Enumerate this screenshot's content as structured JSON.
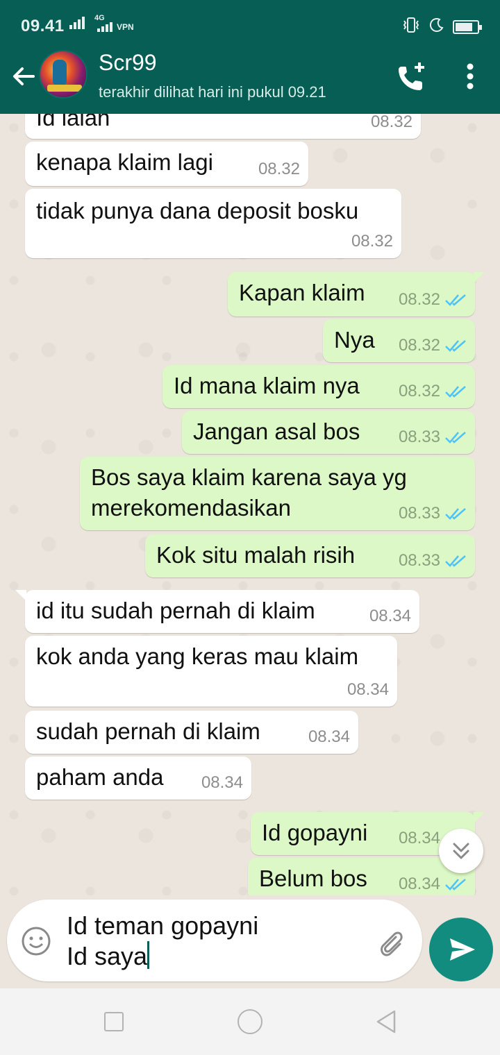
{
  "status_bar": {
    "time": "09.41",
    "network": "4G",
    "vpn": "VPN"
  },
  "header": {
    "contact_name": "Scr99",
    "last_seen": "terakhir dilihat hari ini pukul 09.21",
    "icons": [
      "arrow-back-icon",
      "add-call-icon",
      "more-vert-icon"
    ]
  },
  "messages": [
    {
      "dir": "in",
      "text": "Id lalan",
      "time": "08.32"
    },
    {
      "dir": "in",
      "text": "kenapa klaim lagi",
      "time": "08.32"
    },
    {
      "dir": "in",
      "text": "tidak punya dana deposit bosku",
      "time": "08.32"
    },
    {
      "dir": "out",
      "text": "Kapan klaim",
      "time": "08.32"
    },
    {
      "dir": "out",
      "text": "Nya",
      "time": "08.32"
    },
    {
      "dir": "out",
      "text": "Id mana klaim nya",
      "time": "08.32"
    },
    {
      "dir": "out",
      "text": "Jangan asal bos",
      "time": "08.33"
    },
    {
      "dir": "out",
      "text": "Bos saya klaim karena saya yg\nmerekomendasikan",
      "time": "08.33"
    },
    {
      "dir": "out",
      "text": "Kok situ malah risih",
      "time": "08.33"
    },
    {
      "dir": "in",
      "text": "id itu sudah pernah di klaim",
      "time": "08.34"
    },
    {
      "dir": "in",
      "text": "kok anda yang keras mau klaim",
      "time": "08.34"
    },
    {
      "dir": "in",
      "text": "sudah pernah di klaim",
      "time": "08.34"
    },
    {
      "dir": "in",
      "text": "paham anda",
      "time": "08.34"
    },
    {
      "dir": "out",
      "text": "Id gopayni",
      "time": "08.34"
    },
    {
      "dir": "out",
      "text": "Belum bos",
      "time": "08.34"
    }
  ],
  "composer": {
    "text": "Id teman gopayni\nId saya"
  },
  "colors": {
    "header": "#075e54",
    "outgoing_bubble": "#dcf8c6",
    "incoming_bubble": "#ffffff",
    "send_button": "#128c7e",
    "read_tick": "#4fc3f7"
  }
}
